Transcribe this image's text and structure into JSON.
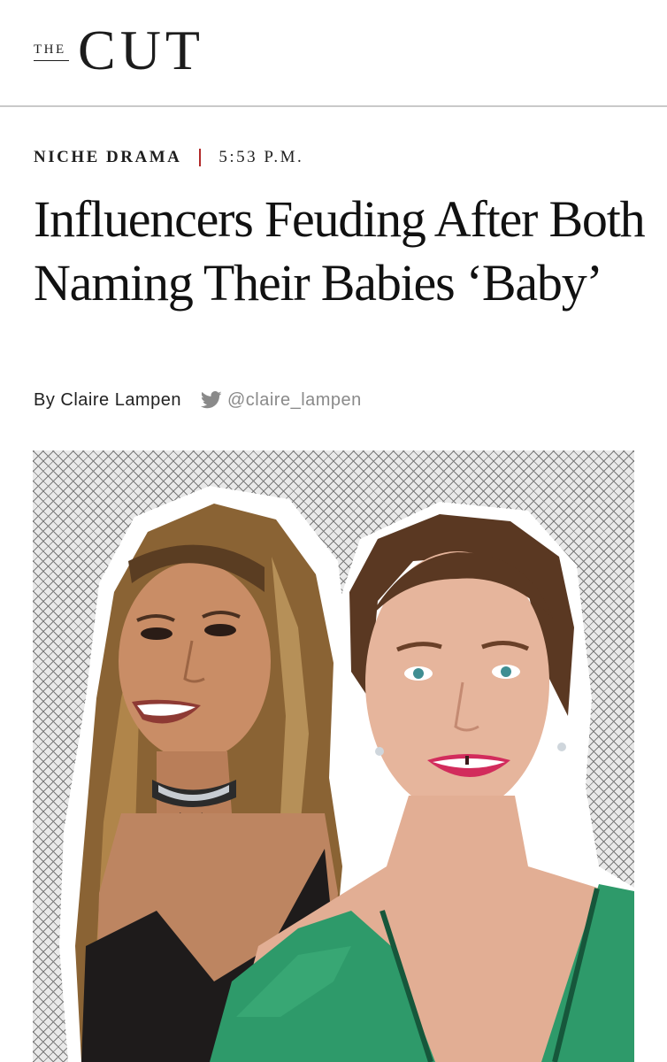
{
  "masthead": {
    "logo_the": "THE",
    "logo_cut": "CUT"
  },
  "article": {
    "rubric": "NICHE DRAMA",
    "timestamp": "5:53 P.M.",
    "headline": "Influencers Feuding After Both Naming Their Babies ‘Baby’",
    "byline": "By Claire Lampen",
    "twitter_handle": "@claire_lampen"
  },
  "icons": {
    "twitter": "twitter-bird-icon"
  },
  "colors": {
    "separator": "#b22a2a",
    "secondary_text": "#8a8a8a",
    "dress_green": "#2e9a6a"
  }
}
